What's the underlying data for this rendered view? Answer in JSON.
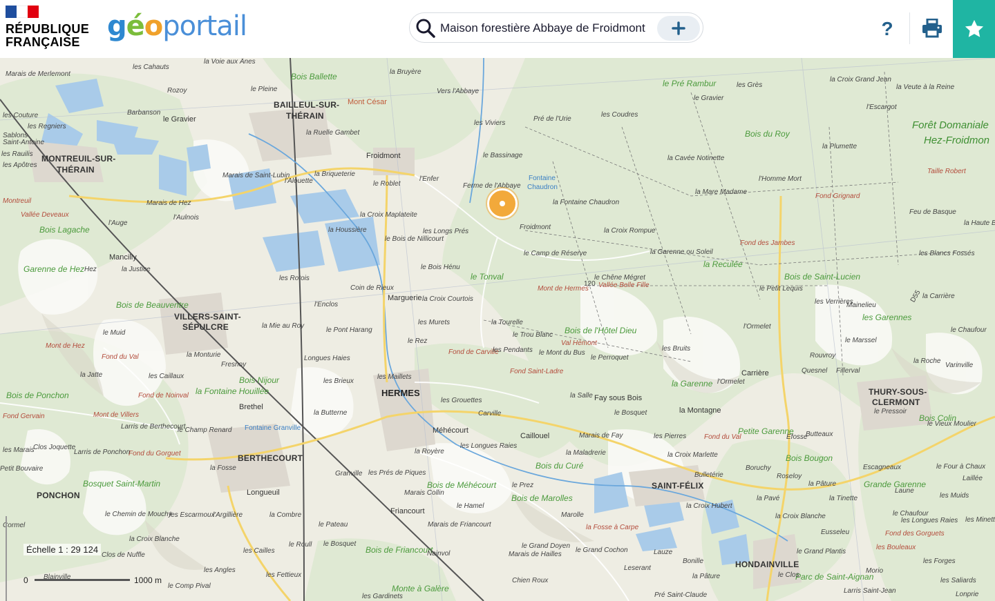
{
  "header": {
    "rf_line1": "RÉPUBLIQUE",
    "rf_line2": "FRANÇAISE",
    "logo_geo": "géo",
    "logo_portail": "portail",
    "search_value": "Maison forestière Abbaye de Froidmont",
    "help_label": "?",
    "colors": {
      "blue": "#1f4e9e",
      "red": "#e1000f",
      "accent": "#1fb5a3",
      "portail_blue": "#4a8fd8"
    }
  },
  "map": {
    "towns": [
      {
        "id": "bailleul",
        "t": "BAILLEUL-SUR-"
      },
      {
        "id": "therain",
        "t": "THÉRAIN"
      },
      {
        "id": "montreuil",
        "t": "MONTREUIL-SUR-"
      },
      {
        "id": "therain2",
        "t": "THÉRAIN"
      },
      {
        "id": "villers",
        "t": "VILLERS-SAINT-"
      },
      {
        "id": "sepulcre",
        "t": "SÉPULCRE"
      },
      {
        "id": "hermes",
        "t": "HERMES"
      },
      {
        "id": "berthecourt",
        "t": "BERTHECOURT"
      },
      {
        "id": "ponchon",
        "t": "PONCHON"
      },
      {
        "id": "saintfelix",
        "t": "SAINT-FÉLIX"
      },
      {
        "id": "hondainville",
        "t": "HONDAINVILLE"
      },
      {
        "id": "thury",
        "t": "THURY-SOUS-"
      },
      {
        "id": "clermont",
        "t": "CLERMONT"
      }
    ],
    "villages": [
      {
        "t": "Froidmont"
      },
      {
        "t": "Marguerie"
      },
      {
        "t": "Mancilly"
      },
      {
        "t": "Caillouel"
      },
      {
        "t": "Méhécourt"
      },
      {
        "t": "Friancourt"
      },
      {
        "t": "Longueuil"
      },
      {
        "t": "Carrière"
      },
      {
        "t": "Fay sous Bois"
      },
      {
        "t": "Brethel"
      }
    ],
    "forests": [
      {
        "t": "Bois Ballette"
      },
      {
        "t": "le Pré Rambur"
      },
      {
        "t": "Bois du Roy"
      },
      {
        "t": "Bois Lagache"
      },
      {
        "t": "Garenne de Hez"
      },
      {
        "t": "Bois de Beauventre"
      },
      {
        "t": "le Tonval"
      },
      {
        "t": "la Reculée"
      },
      {
        "t": "Bois de Saint-Lucien"
      },
      {
        "t": "Bois de l'Hôtel Dieu"
      },
      {
        "t": "Bois de Ponchon"
      },
      {
        "t": "Bois Nijour"
      },
      {
        "t": "la Garenne"
      },
      {
        "t": "Petite Garenne"
      },
      {
        "t": "Bois Bougon"
      },
      {
        "t": "Bois du Curé"
      },
      {
        "t": "Bois de Marolles"
      },
      {
        "t": "Bois de Méhécourt"
      },
      {
        "t": "Bosquet Saint-Martin"
      },
      {
        "t": "Bois de Friancourt"
      },
      {
        "t": "Parc de Saint-Aignan"
      },
      {
        "t": "Grande Garenne"
      },
      {
        "t": "les Garennes"
      },
      {
        "t": "Bois Colin"
      },
      {
        "t": "la Fontaine Houillée"
      },
      {
        "t": "Monte à Galère"
      }
    ],
    "forest_big": [
      {
        "t": "Forêt Domaniale"
      },
      {
        "t": "Hez-Froidmon"
      }
    ],
    "hydro": [
      {
        "t": "Fontaine"
      },
      {
        "t": "Chaudron"
      },
      {
        "t": "Fontaine Granville"
      }
    ],
    "relief": [
      {
        "t": "Mont César"
      },
      {
        "t": "Mont de Hermes"
      },
      {
        "t": "Val Hémont"
      },
      {
        "t": "Fond de Carville"
      },
      {
        "t": "Fond Saint-Ladre"
      },
      {
        "t": "Mont de Hez"
      },
      {
        "t": "Fond du Val"
      },
      {
        "t": "Fond des Jambes"
      },
      {
        "t": "Fond du Gorguet"
      },
      {
        "t": "Fond Grignard"
      },
      {
        "t": "Mont de Villers"
      },
      {
        "t": "Fond du Val"
      },
      {
        "t": "Fond des Gorguets"
      },
      {
        "t": "les Bouleaux"
      },
      {
        "t": "Fond de Noinval"
      },
      {
        "t": "la Fosse à Carpe"
      }
    ],
    "localities": [
      {
        "t": "les Cahauts"
      },
      {
        "t": "la Voie aux Ânes"
      },
      {
        "t": "Marais de Merlemont"
      },
      {
        "t": "le Pleine"
      },
      {
        "t": "la Bruyère"
      },
      {
        "t": "Vers l'Abbaye"
      },
      {
        "t": "les Viviers"
      },
      {
        "t": "Pré de l'Urie"
      },
      {
        "t": "les Coudres"
      },
      {
        "t": "les Grès"
      },
      {
        "t": "le Gravier"
      },
      {
        "t": "la Croix Grand Jean"
      },
      {
        "t": "la Veute à la Reine"
      },
      {
        "t": "l'Escargot"
      },
      {
        "t": "Rozoy"
      },
      {
        "t": "Barbanson"
      },
      {
        "t": "le Gravier"
      },
      {
        "t": "la Ruelle Gambet"
      },
      {
        "t": "le Bassinage"
      },
      {
        "t": "Ferme de l'Abbaye"
      },
      {
        "t": "la Croix Maplateite"
      },
      {
        "t": "la Fontaine Chaudron"
      },
      {
        "t": "la Cavée Notinette"
      },
      {
        "t": "la Plumette"
      },
      {
        "t": "l'Homme Mort"
      },
      {
        "t": "la Mare Madame"
      },
      {
        "t": "Taille Robert"
      },
      {
        "t": "Marais de Saint-Lubin"
      },
      {
        "t": "l'Alouette"
      },
      {
        "t": "la Briqueterie"
      },
      {
        "t": "le Roblet"
      },
      {
        "t": "l'Enfer"
      },
      {
        "t": "les Longs Prés"
      },
      {
        "t": "le Bois de Nillicourt"
      },
      {
        "t": "Froidmont"
      },
      {
        "t": "la Croix Rompue"
      },
      {
        "t": "Feu de Basque"
      },
      {
        "t": "la Haute Borne"
      },
      {
        "t": "Marais de Hez"
      },
      {
        "t": "l'Aulnois"
      },
      {
        "t": "l'Auge"
      },
      {
        "t": "la Houssière"
      },
      {
        "t": "le Camp de Réserve"
      },
      {
        "t": "la Garenne ou Soleil"
      },
      {
        "t": "les Blancs Fossés"
      },
      {
        "t": "la Justice"
      },
      {
        "t": "les Rotois"
      },
      {
        "t": "le Bois Hénu"
      },
      {
        "t": "Coin de Rieux"
      },
      {
        "t": "la Croix Courtois"
      },
      {
        "t": "le Chêne Mégret"
      },
      {
        "t": "Vallée Belle Fille"
      },
      {
        "t": "le Petit Lequis"
      },
      {
        "t": "les Verrières"
      },
      {
        "t": "Mainelieu"
      },
      {
        "t": "la Carrière"
      },
      {
        "t": "l'Enclos"
      },
      {
        "t": "la Mie au Roy"
      },
      {
        "t": "le Pont Harang"
      },
      {
        "t": "les Murets"
      },
      {
        "t": "la Tourelle"
      },
      {
        "t": "le Trou Blanc"
      },
      {
        "t": "l'Ormelet"
      },
      {
        "t": "le Chaufour"
      },
      {
        "t": "le Muid"
      },
      {
        "t": "la Monturie"
      },
      {
        "t": "le Rez"
      },
      {
        "t": "les Pendants"
      },
      {
        "t": "le Mont du Bus"
      },
      {
        "t": "le Perroquet"
      },
      {
        "t": "les Bruits"
      },
      {
        "t": "le Marssel"
      },
      {
        "t": "Fresnoy"
      },
      {
        "t": "Longues Haies"
      },
      {
        "t": "les Maillets"
      },
      {
        "t": "Rouvroy"
      },
      {
        "t": "Quesnel"
      },
      {
        "t": "Fillerval"
      },
      {
        "t": "la Roche"
      },
      {
        "t": "Varinville"
      },
      {
        "t": "la Jatte"
      },
      {
        "t": "les Caillaux"
      },
      {
        "t": "les Brieux"
      },
      {
        "t": "les Grouettes"
      },
      {
        "t": "la Salle"
      },
      {
        "t": "le Bosquet"
      },
      {
        "t": "l'Ormelet"
      },
      {
        "t": "la Butterne"
      },
      {
        "t": "Carville"
      },
      {
        "t": "la Montagne"
      },
      {
        "t": "le Pressoir"
      },
      {
        "t": "Larris de Berthecourt"
      },
      {
        "t": "le Champ Renard"
      },
      {
        "t": "les Pierres"
      },
      {
        "t": "Efosse"
      },
      {
        "t": "Butteaux"
      },
      {
        "t": "le Vieux Moulier"
      },
      {
        "t": "Clos Joquette"
      },
      {
        "t": "Larris de Ponchon"
      },
      {
        "t": "la Royère"
      },
      {
        "t": "les Longues Raies"
      },
      {
        "t": "Marais de Fay"
      },
      {
        "t": "la Maladrerie"
      },
      {
        "t": "la Croix Marlette"
      },
      {
        "t": "Boruchy"
      },
      {
        "t": "Escagneaux"
      },
      {
        "t": "le Four à Chaux"
      },
      {
        "t": "Laillée"
      },
      {
        "t": "la Fosse"
      },
      {
        "t": "Granville"
      },
      {
        "t": "les Prés de Piques"
      },
      {
        "t": "Bulletérie"
      },
      {
        "t": "Roseloy"
      },
      {
        "t": "la Pâture"
      },
      {
        "t": "Laune"
      },
      {
        "t": "les Muids"
      },
      {
        "t": "Marais Collin"
      },
      {
        "t": "le Hamel"
      },
      {
        "t": "le Prez"
      },
      {
        "t": "la Pavé"
      },
      {
        "t": "la Tinette"
      },
      {
        "t": "le Chemin de Mouchy"
      },
      {
        "t": "les Escarmoux"
      },
      {
        "t": "l'Argillière"
      },
      {
        "t": "la Combre"
      },
      {
        "t": "Marolle"
      },
      {
        "t": "la Croix Hubert"
      },
      {
        "t": "la Croix Blanche"
      },
      {
        "t": "le Chaufour"
      },
      {
        "t": "les Longues Raies"
      },
      {
        "t": "les Minettes"
      },
      {
        "t": "la Croix Blanche"
      },
      {
        "t": "le Pateau"
      },
      {
        "t": "Marais de Friancourt"
      },
      {
        "t": "Eusseleu"
      },
      {
        "t": "le Roull"
      },
      {
        "t": "les Cailles"
      },
      {
        "t": "le Bosquet"
      },
      {
        "t": "le Grand Doyen"
      },
      {
        "t": "Marais de Hailles"
      },
      {
        "t": "le Grand Cochon"
      },
      {
        "t": "Lauze"
      },
      {
        "t": "le Grand Plantis"
      },
      {
        "t": "les Forges"
      },
      {
        "t": "Clos de Nuffle"
      },
      {
        "t": "les Angles"
      },
      {
        "t": "les Fettieux"
      },
      {
        "t": "Nainvol"
      },
      {
        "t": "Leserant"
      },
      {
        "t": "Bonille"
      },
      {
        "t": "la Pâture"
      },
      {
        "t": "le Clos"
      },
      {
        "t": "Morio"
      },
      {
        "t": "les Saliards"
      },
      {
        "t": "le Comp Pival"
      },
      {
        "t": "les Gardinets"
      },
      {
        "t": "Chien Roux"
      },
      {
        "t": "Pré Saint-Claude"
      },
      {
        "t": "Larris Saint-Jean"
      },
      {
        "t": "Lonprie"
      },
      {
        "t": "les Couture"
      },
      {
        "t": "les Regniers"
      },
      {
        "t": "Sablons"
      },
      {
        "t": "Saint-Antoine"
      },
      {
        "t": "les Rauilis"
      },
      {
        "t": "les Apôtres"
      },
      {
        "t": "Montreuil"
      },
      {
        "t": "Vallée Deveaux"
      },
      {
        "t": "Hez"
      },
      {
        "t": "Fond Gervain"
      },
      {
        "t": "les Marais"
      },
      {
        "t": "Petit Bouvaire"
      },
      {
        "t": "Blainville"
      },
      {
        "t": "Cormel"
      }
    ],
    "road_code": "D55",
    "elevation": "120"
  },
  "scale": {
    "label": "Échelle 1 : 29 124",
    "zero": "0",
    "end": "1000 m",
    "bar_fraction": 1.0
  }
}
